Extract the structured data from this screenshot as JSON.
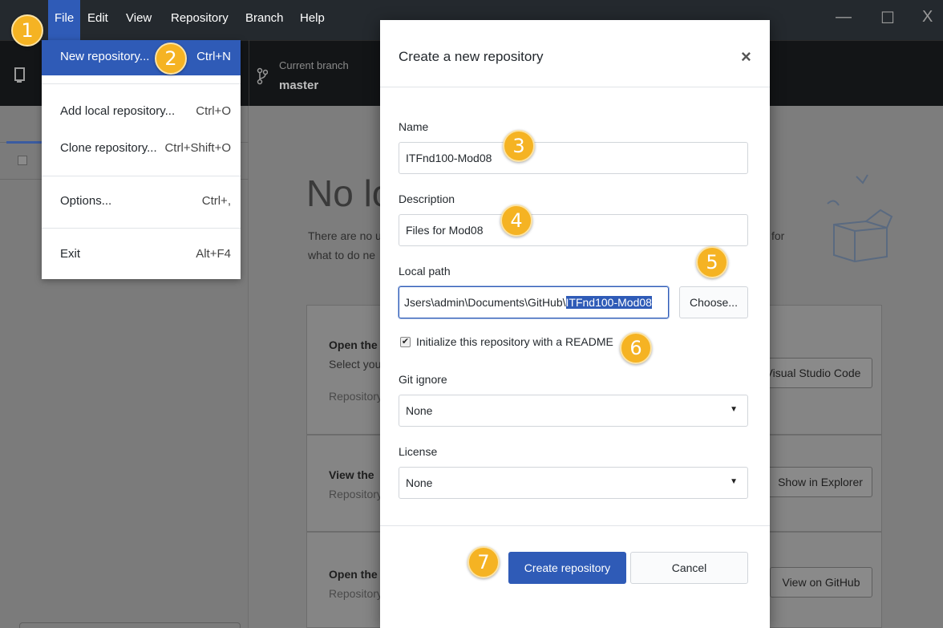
{
  "menubar": {
    "items": [
      "File",
      "Edit",
      "View",
      "Repository",
      "Branch",
      "Help"
    ],
    "window_controls": [
      "—",
      "☐",
      "X"
    ]
  },
  "toolbar": {
    "branch_label": "Current branch",
    "branch_name": "master"
  },
  "file_menu": {
    "items": [
      {
        "label": "New repository...",
        "shortcut": "Ctrl+N"
      },
      {
        "label": "Add local repository...",
        "shortcut": "Ctrl+O"
      },
      {
        "label": "Clone repository...",
        "shortcut": "Ctrl+Shift+O"
      },
      {
        "label": "Options...",
        "shortcut": "Ctrl+,"
      },
      {
        "label": "Exit",
        "shortcut": "Alt+F4"
      }
    ]
  },
  "background": {
    "heading": "No lo",
    "sub1": "There are no u",
    "sub2": "what to do ne",
    "sub_for": "for",
    "cards": [
      {
        "title": "Open the",
        "text": "Select you",
        "sub": "Repository",
        "button": "Visual Studio Code"
      },
      {
        "title": "View the",
        "sub": "Repository",
        "button": "Show in Explorer"
      },
      {
        "title": "Open the",
        "sub": "Repository",
        "button": "View on GitHub"
      }
    ]
  },
  "dialog": {
    "title": "Create a new repository",
    "close_glyph": "×",
    "name_label": "Name",
    "name_value": "ITFnd100-Mod08",
    "description_label": "Description",
    "description_value": "Files for Mod08",
    "local_path_label": "Local path",
    "local_path_prefix": "Jsers\\admin\\Documents\\GitHub\\",
    "local_path_selected": "ITFnd100-Mod08",
    "choose_button": "Choose...",
    "readme_checked": true,
    "readme_label": "Initialize this repository with a README",
    "gitignore_label": "Git ignore",
    "gitignore_value": "None",
    "license_label": "License",
    "license_value": "None",
    "create_button": "Create repository",
    "cancel_button": "Cancel"
  },
  "callouts": [
    "1",
    "2",
    "3",
    "4",
    "5",
    "6",
    "7"
  ],
  "colors": {
    "accent": "#2f5bb7",
    "callout": "#f5b323",
    "titlebar": "#24292e"
  }
}
